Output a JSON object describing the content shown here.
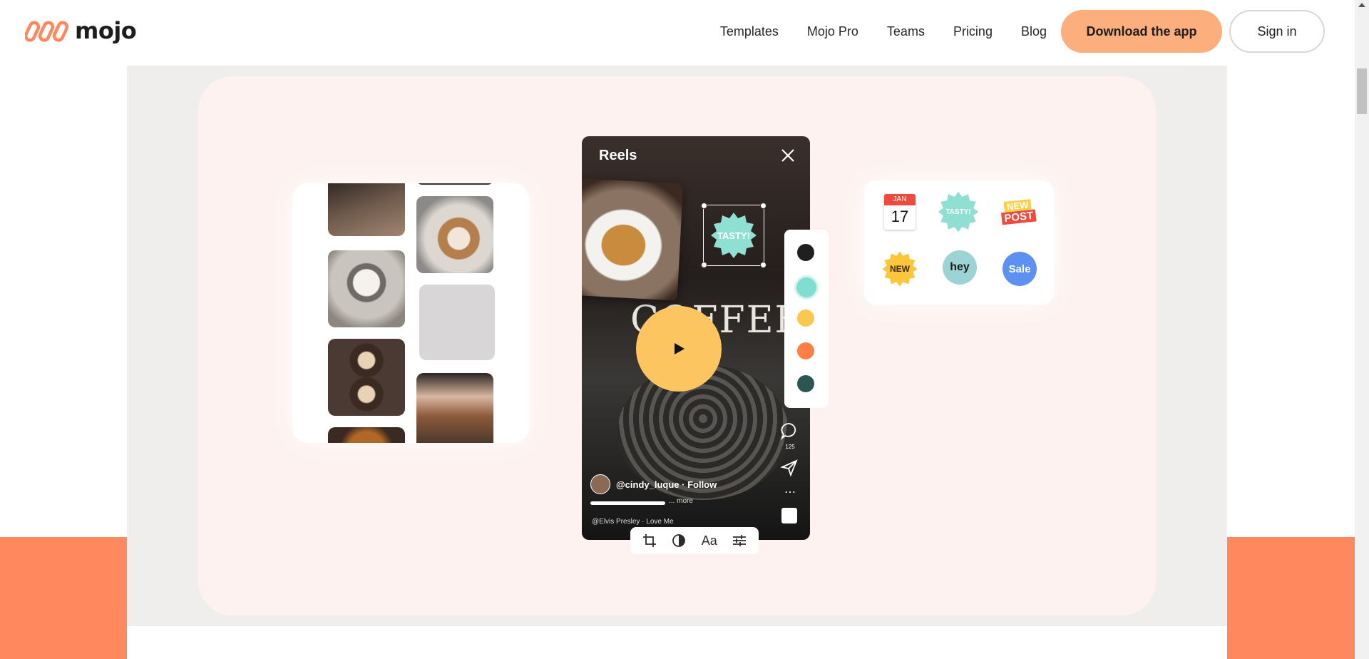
{
  "header": {
    "logo_text": "mojo",
    "nav": [
      "Templates",
      "Mojo Pro",
      "Teams",
      "Pricing",
      "Blog"
    ],
    "download_label": "Download the app",
    "signin_label": "Sign in"
  },
  "hero": {
    "phone": {
      "title": "Reels",
      "background_text": "COFFEE",
      "sticker_text": "TASTY!",
      "user_handle": "@cindy_luque · Follow",
      "caption_more": "... more",
      "music": "@Elvis Presley · Love Me",
      "comment_count": "125"
    },
    "palette_colors": [
      "#1f1f1f",
      "#7fddd1",
      "#fcc74f",
      "#ff8045",
      "#2a5754"
    ],
    "edit_tools": [
      "crop-icon",
      "contrast-icon",
      "Aa",
      "sliders-icon"
    ],
    "stickers": {
      "calendar_month": "JAN",
      "calendar_day": "17",
      "tasty": "TASTY!",
      "new_post_1": "NEW",
      "new_post_2": "POST",
      "new": "NEW",
      "hey": "hey",
      "sale": "Sale"
    }
  },
  "colors": {
    "accent": "#fcae7d",
    "band": "#ff885e",
    "play": "#fdc55f"
  }
}
